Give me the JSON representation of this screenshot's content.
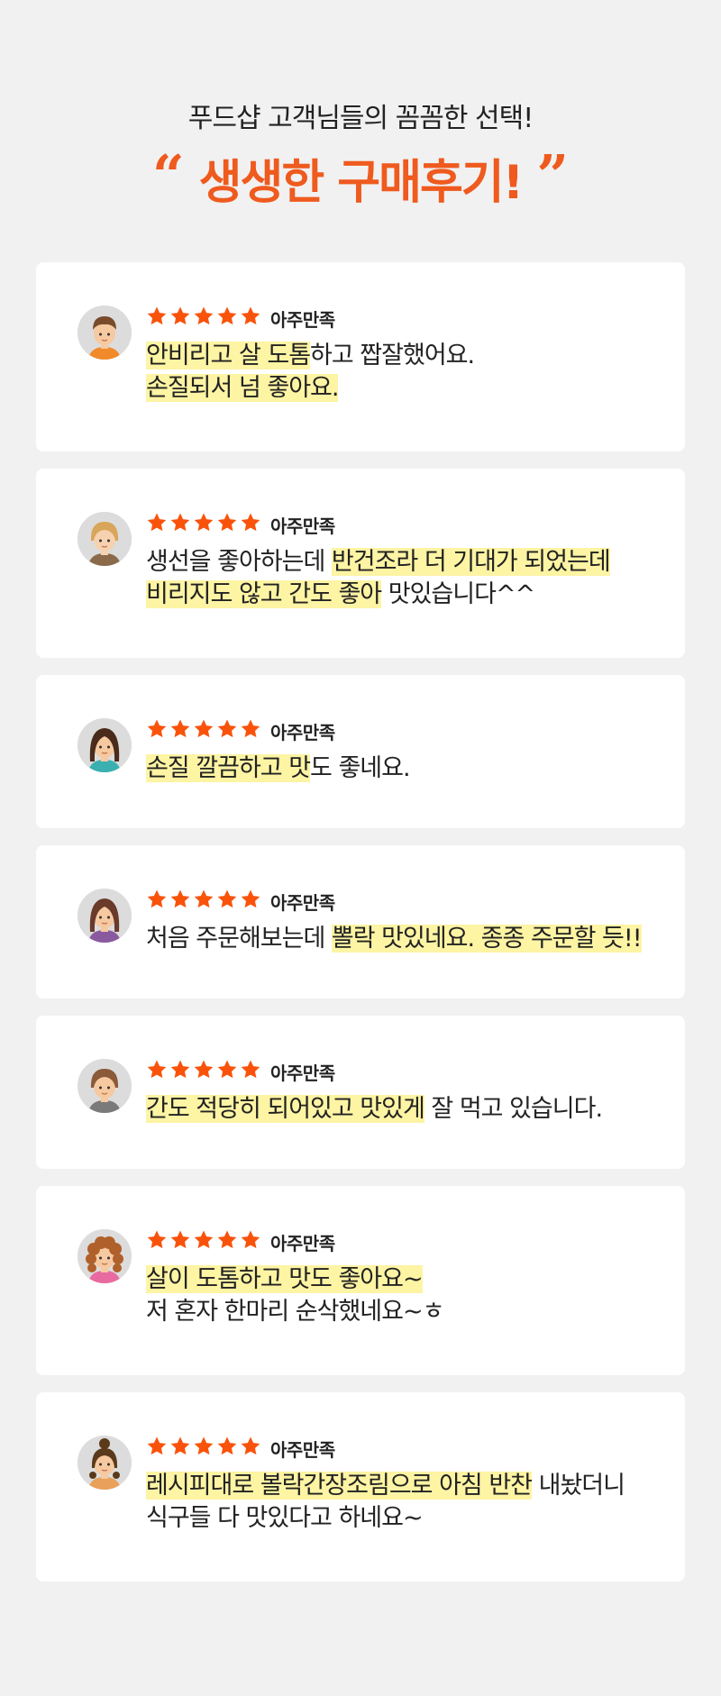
{
  "header": {
    "subtitle": "푸드샵 고객님들의 꼼꼼한 선택!",
    "open_quote": "“",
    "title": "생생한 구매후기!",
    "close_quote": "”"
  },
  "colors": {
    "accent": "#ef5a1e",
    "star": "#f9530b",
    "highlight": "#fdf4a4",
    "background": "#f1f1f1",
    "card": "#ffffff"
  },
  "rating_label": "아주만족",
  "star_count": 5,
  "reviews": [
    {
      "avatar": "boy-avatar-icon",
      "lines": [
        [
          {
            "t": "안비리고 살 도톰",
            "h": true
          },
          {
            "t": "하고 짭잘했어요.",
            "h": false
          }
        ],
        [
          {
            "t": "손질되서 넘 좋아요.",
            "h": true
          }
        ]
      ]
    },
    {
      "avatar": "blond-avatar-icon",
      "lines": [
        [
          {
            "t": "생선을 좋아하는데 ",
            "h": false
          },
          {
            "t": "반건조라 더 기대가 되었는데",
            "h": true
          }
        ],
        [
          {
            "t": "비리지도 않고 간도 좋아",
            "h": true
          },
          {
            "t": " 맛있습니다^^",
            "h": false
          }
        ]
      ]
    },
    {
      "avatar": "girl-avatar-icon",
      "lines": [
        [
          {
            "t": "손질 깔끔하고 맛",
            "h": true
          },
          {
            "t": "도 좋네요.",
            "h": false
          }
        ]
      ]
    },
    {
      "avatar": "woman-avatar-icon",
      "lines": [
        [
          {
            "t": "처음 주문해보는데 ",
            "h": false
          },
          {
            "t": "뽈락 맛있네요. 종종 주문할 듯!!",
            "h": true
          }
        ]
      ]
    },
    {
      "avatar": "man-avatar-icon",
      "lines": [
        [
          {
            "t": "간도 적당히 되어있고 맛있게",
            "h": true
          },
          {
            "t": " 잘 먹고 있습니다.",
            "h": false
          }
        ]
      ]
    },
    {
      "avatar": "curly-avatar-icon",
      "lines": [
        [
          {
            "t": "살이 도톰하고 맛도 좋아요~",
            "h": true
          }
        ],
        [
          {
            "t": "저 혼자 한마리 순삭했네요~ㅎ",
            "h": false
          }
        ]
      ]
    },
    {
      "avatar": "bun-avatar-icon",
      "lines": [
        [
          {
            "t": "레시피대로 볼락간장조림으로 아침 반찬",
            "h": true
          },
          {
            "t": " 내놨더니",
            "h": false
          }
        ],
        [
          {
            "t": "식구들 다 맛있다고 하네요~",
            "h": false
          }
        ]
      ]
    }
  ]
}
